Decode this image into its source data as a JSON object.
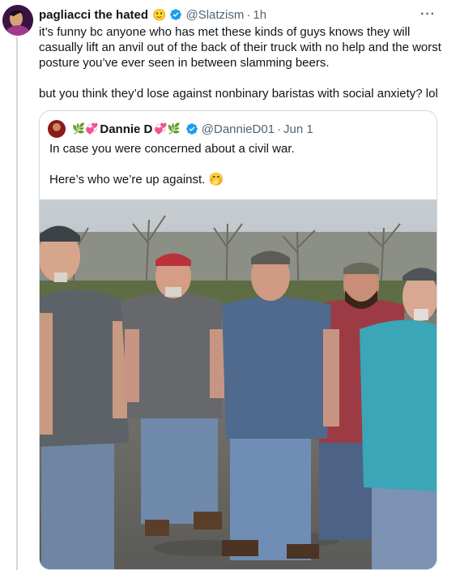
{
  "tweet": {
    "author_name": "pagliacci the hated",
    "author_emoji": "🙂",
    "handle": "@Slatzism",
    "separator": "·",
    "time": "1h",
    "more_label": "···",
    "paragraphs": [
      "it’s funny bc anyone who has met these kinds of guys knows they will casually lift an anvil out of the back of their truck with no help and the worst posture you’ve ever seen in between slamming beers.",
      "but you think they’d lose against nonbinary baristas with social anxiety? lol"
    ],
    "icons": {
      "avatar": "profile-avatar",
      "verified": "verified-badge-icon",
      "more": "more-options-icon"
    },
    "colors": {
      "verified": "#1d9bf0",
      "thread_line": "#cfd9de",
      "secondary_text": "#536471"
    }
  },
  "quote": {
    "deco_left": "🌿💞",
    "author_name": "Dannie D",
    "deco_right": "💞🌿",
    "handle": "@DannieD01",
    "separator": "·",
    "date": "Jun 1",
    "paragraphs": [
      "In case you were concerned about a civil war.",
      "Here’s who we’re up against. 🤭"
    ],
    "media": {
      "kind": "photo",
      "subject": "five men standing in a parking lot"
    }
  }
}
